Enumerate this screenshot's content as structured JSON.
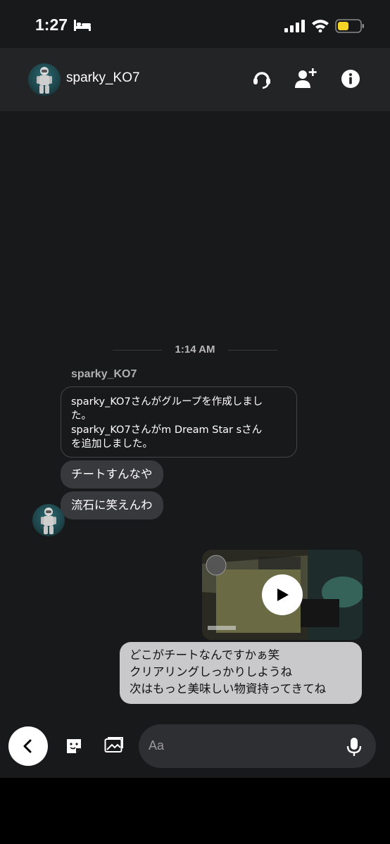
{
  "status_bar": {
    "time": "1:27",
    "icons": [
      "bed-icon",
      "signal-icon",
      "wifi-icon",
      "battery-icon"
    ],
    "battery_color": "#f5d327"
  },
  "header": {
    "username": "sparky_KO7",
    "actions": [
      "call-icon",
      "add-user-icon",
      "info-icon"
    ]
  },
  "chat": {
    "timestamp": "1:14 AM",
    "sender": "sparky_KO7",
    "system_message": [
      "sparky_KO7さんがグループを作成しまし",
      "た。",
      "sparky_KO7さんがm Dream Star sさん",
      "を追加しました。"
    ],
    "incoming": [
      "チートすんなや",
      "流石に笑えんわ"
    ],
    "outgoing_video": {
      "icon": "play-icon"
    },
    "outgoing_text": [
      "どこがチートなんですかぁ笑",
      "クリアリングしっかりしようね",
      "次はもっと美味しい物資持ってきてね"
    ]
  },
  "composer": {
    "placeholder": "Aa",
    "icons": [
      "back-icon",
      "sticker-icon",
      "gallery-icon",
      "mic-icon"
    ]
  },
  "colors": {
    "background": "#18191b",
    "header": "#232426",
    "incoming_bubble": "#38393c",
    "outgoing_bubble": "#c9c9cb"
  }
}
